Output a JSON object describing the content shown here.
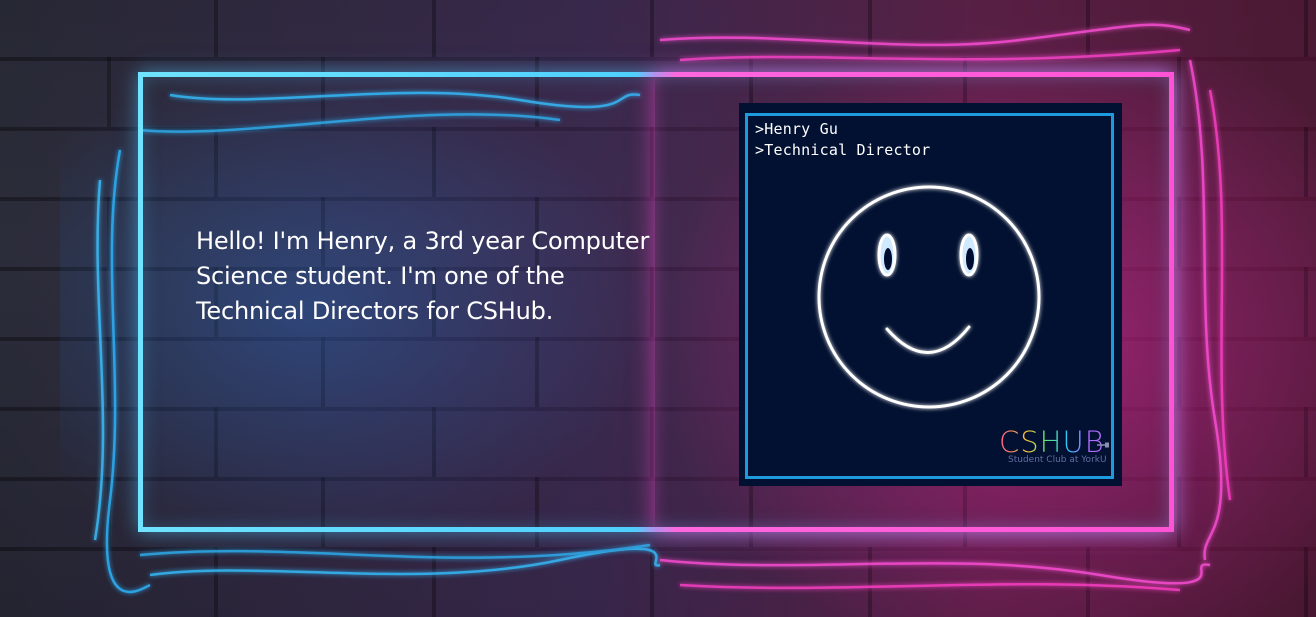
{
  "bio": {
    "line1": "Hello! I'm Henry, a 3rd year Computer",
    "line2": "Science student. I'm one of the",
    "line3": "Technical Directors for CSHub."
  },
  "card": {
    "name_line": ">Henry Gu",
    "role_line": ">Technical Director",
    "logo_text": "CSHUB",
    "logo_subtitle": "Student Club at YorkU",
    "border_color": "#1d9bdc",
    "background_color": "#021131"
  },
  "theme": {
    "neon_blue": "#4fd0ff",
    "neon_pink": "#ff54d6"
  },
  "icons": {
    "smiley": "smiley-face-icon",
    "plug": "plug-icon"
  }
}
